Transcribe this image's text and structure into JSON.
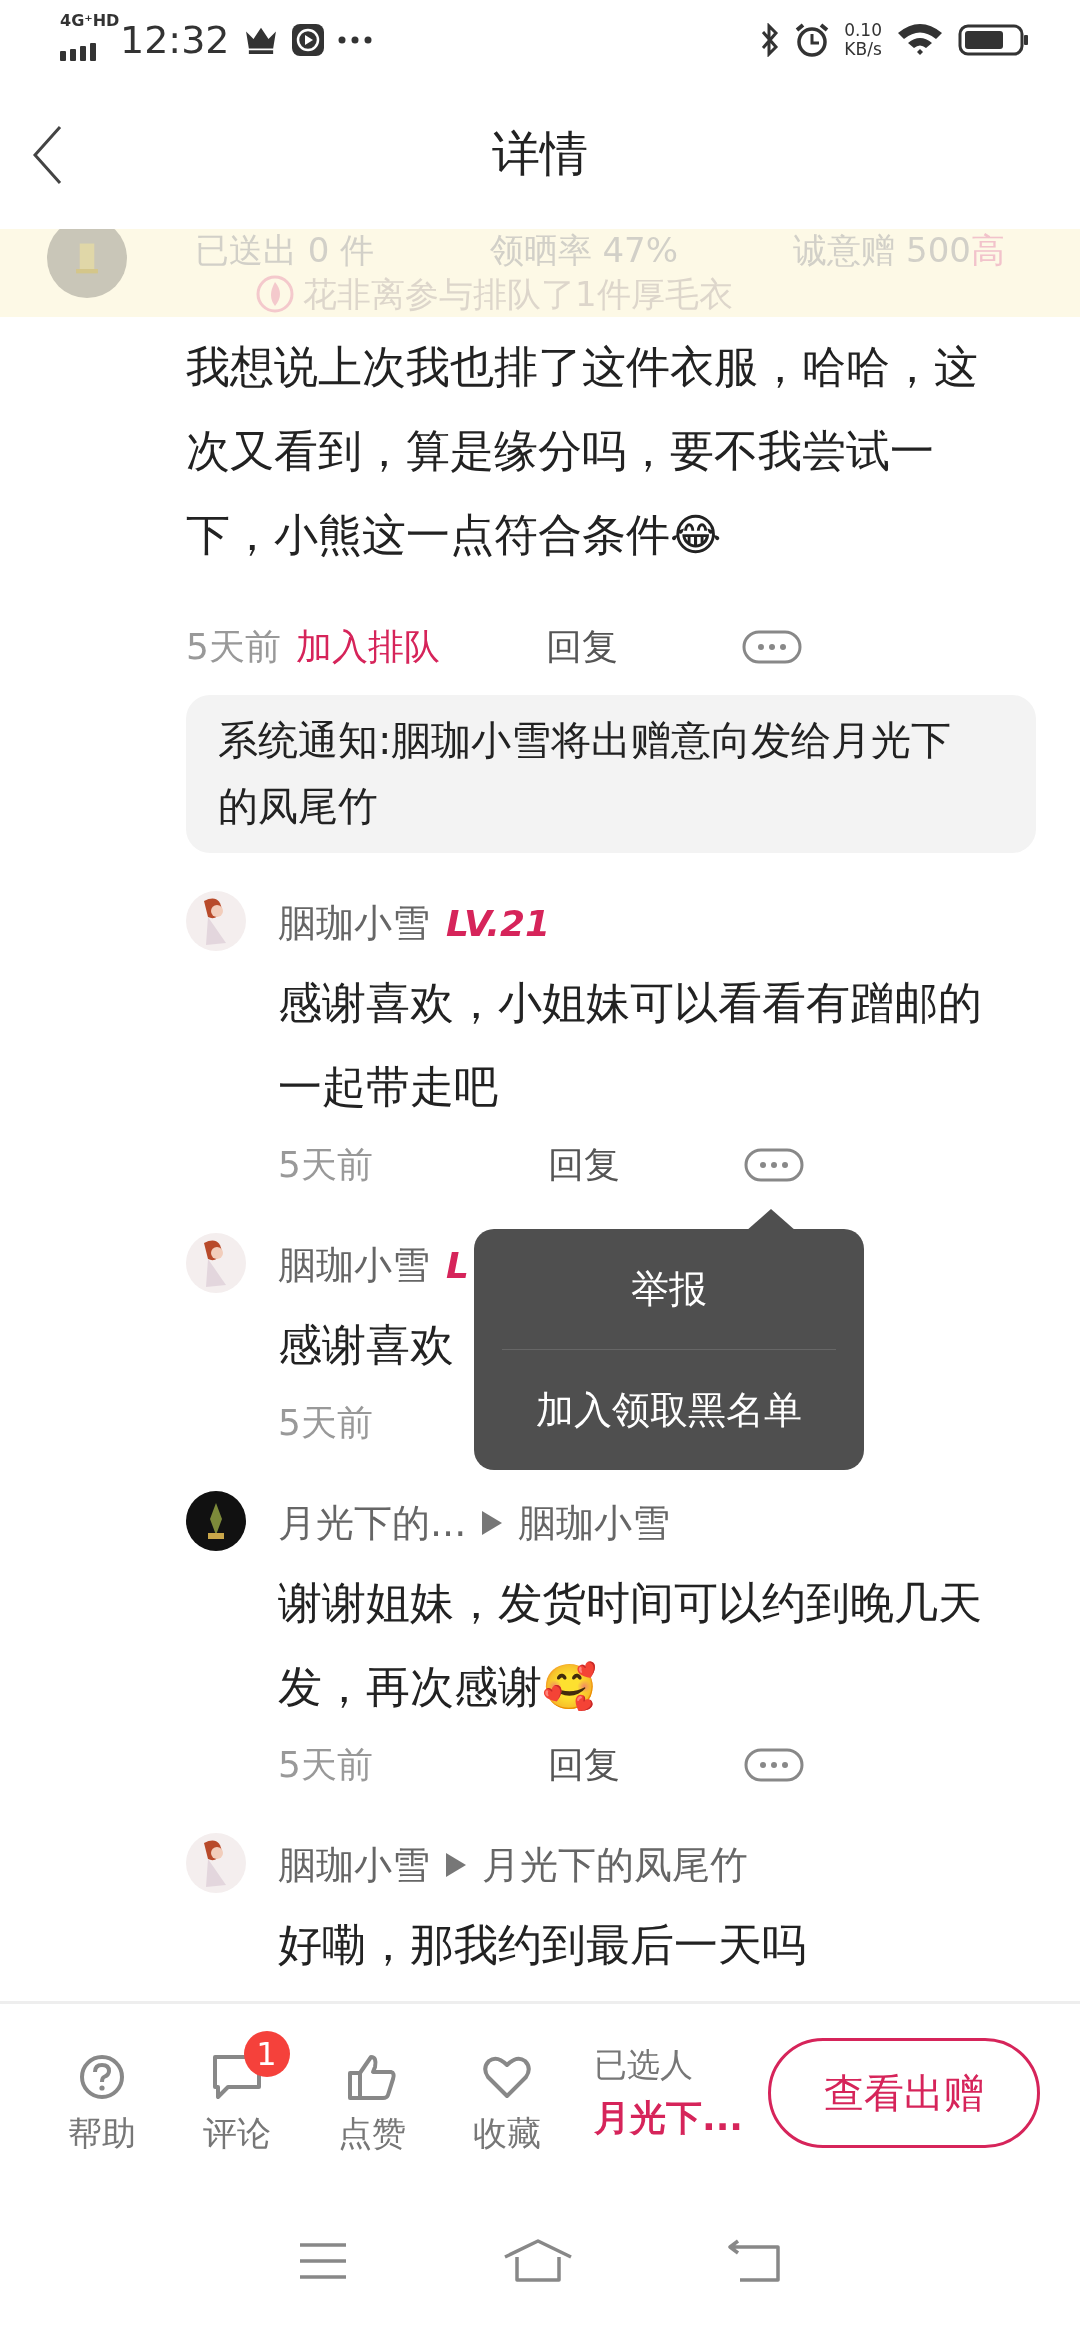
{
  "status_bar": {
    "network": "4G⁺HD",
    "time": "12:32",
    "speed": "0.10",
    "speed_unit": "KB/s"
  },
  "header": {
    "title": "详情"
  },
  "banner": {
    "stats": [
      "已送出 0 件",
      "领晒率 47%",
      "诚意赠 500"
    ],
    "stat_badge": "高",
    "toast": "花非离参与排队了1件厚毛衣"
  },
  "post": {
    "text": "我想说上次我也排了这件衣服，哈哈，这次又看到，算是缘分吗，要不我尝试一下，小熊这一点符合条件😂",
    "time": "5天前",
    "queue_link": "加入排队",
    "reply": "回复"
  },
  "notice": {
    "text": "系统通知:胭珈小雪将出赠意向发给月光下的凤尾竹"
  },
  "replies": [
    {
      "name": "胭珈小雪",
      "level": "LV.21",
      "text": "感谢喜欢，小姐妹可以看看有蹭邮的一起带走吧",
      "time": "5天前",
      "reply": "回复",
      "more": true
    },
    {
      "name": "胭珈小雪",
      "level": "L",
      "text": "感谢喜欢",
      "time": "5天前",
      "more": false
    },
    {
      "name": "月光下的...",
      "target": "胭珈小雪",
      "text": "谢谢姐妹，发货时间可以约到晚几天发，再次感谢🥰",
      "time": "5天前",
      "reply": "回复",
      "more": true
    },
    {
      "name": "胭珈小雪",
      "target": "月光下的凤尾竹",
      "text": "好嘞，那我约到最后一天吗"
    }
  ],
  "popup_menu": {
    "items": [
      "举报",
      "加入领取黑名单"
    ]
  },
  "bottom_bar": {
    "actions": [
      {
        "kind": "help",
        "label": "帮助"
      },
      {
        "kind": "comment",
        "label": "评论",
        "badge": "1"
      },
      {
        "kind": "like",
        "label": "点赞"
      },
      {
        "kind": "favorite",
        "label": "收藏"
      }
    ],
    "selected_label": "已选人",
    "selected_name": "月光下...",
    "button": "查看出赠"
  }
}
